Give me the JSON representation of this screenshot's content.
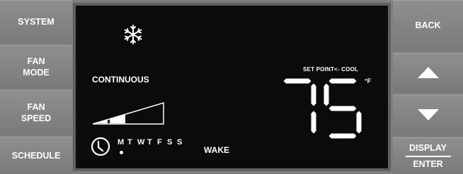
{
  "left_buttons": {
    "system": "SYSTEM",
    "fan_mode": [
      "FAN",
      "MODE"
    ],
    "fan_speed": [
      "FAN",
      "SPEED"
    ],
    "schedule": "SCHEDULE"
  },
  "right_buttons": {
    "back": "BACK",
    "up_icon": "triangle-up",
    "down_icon": "triangle-down",
    "display": "DISPLAY",
    "enter": "ENTER"
  },
  "display": {
    "mode_icon": "snowflake",
    "fan_mode_value": "CONTINUOUS",
    "fan_speed_level": 0.5,
    "set_point_label": "SET POINT<- COOL",
    "temperature": "75",
    "unit": "°F",
    "schedule_days": [
      "M",
      "T",
      "W",
      "T",
      "F",
      "S",
      "S"
    ],
    "active_day_index": 0,
    "period": "WAKE"
  },
  "colors": {
    "button_bg": "#858585",
    "screen_bg": "#0b0b0b",
    "segment": "#ffffff"
  }
}
